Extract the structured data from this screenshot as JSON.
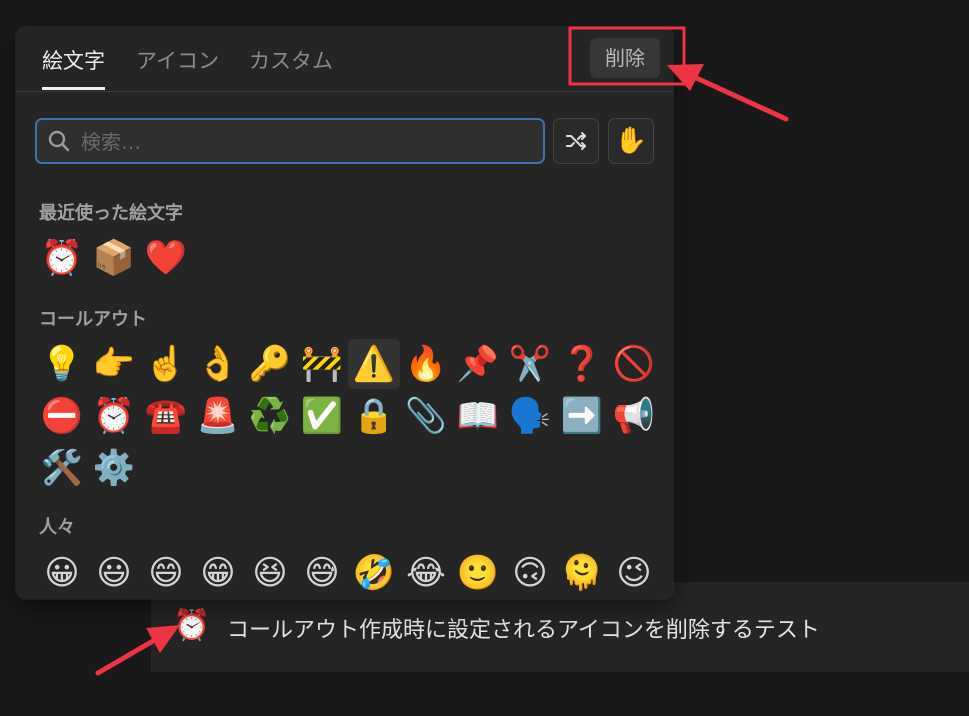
{
  "callout": {
    "icon": "⏰",
    "text": "コールアウト作成時に設定されるアイコンを削除するテスト"
  },
  "picker": {
    "tabs": [
      {
        "label": "絵文字"
      },
      {
        "label": "アイコン"
      },
      {
        "label": "カスタム"
      }
    ],
    "remove_label": "削除",
    "search": {
      "placeholder": "検索…",
      "value": ""
    },
    "shuffle_icon": "shuffle-icon",
    "skin_tone_icon": "✋",
    "sections": [
      {
        "label": "最近使った絵文字",
        "rows": [
          [
            "⏰",
            "📦",
            "❤️"
          ]
        ]
      },
      {
        "label": "コールアウト",
        "rows": [
          [
            "💡",
            "👉",
            "☝️",
            "👌",
            "🔑",
            "🚧",
            "⚠️",
            "🔥",
            "📌",
            "✂️",
            "❓",
            "🚫"
          ],
          [
            "⛔",
            "⏰",
            "☎️",
            "🚨",
            "♻️",
            "✅",
            "🔒",
            "📎",
            "📖",
            "🗣️",
            "➡️",
            "📢"
          ],
          [
            "🛠️",
            "⚙️"
          ]
        ]
      },
      {
        "label": "人々",
        "rows": [
          [
            "😀",
            "😃",
            "😄",
            "😁",
            "😆",
            "😅",
            "🤣",
            "😂",
            "🙂",
            "🙃",
            "🫠",
            "😉"
          ]
        ]
      }
    ]
  },
  "colors": {
    "annotation_red": "#ee3344",
    "search_focus": "#3a72b0"
  }
}
